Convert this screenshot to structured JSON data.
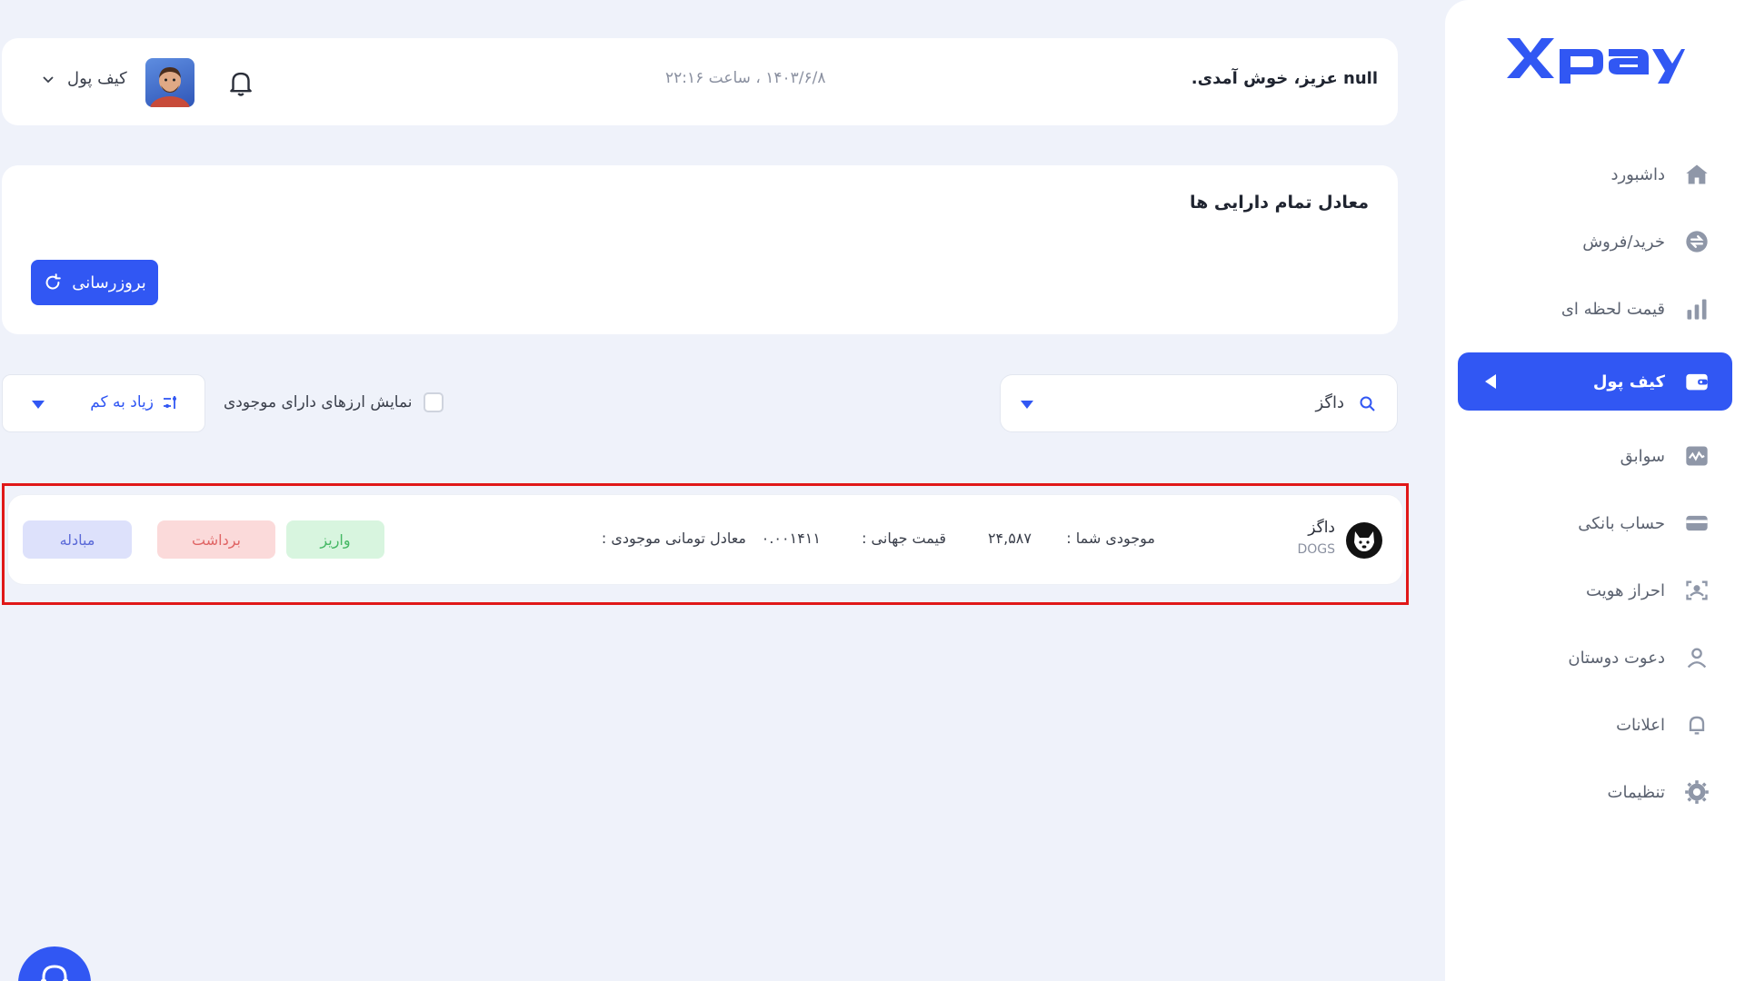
{
  "brand": {
    "logo_text": "xpay",
    "accent": "#3157f3"
  },
  "header": {
    "welcome": "null عزیز، خوش آمدی.",
    "datetime": "۱۴۰۳/۶/۸ ، ساعت ۲۲:۱۶",
    "wallet_label": "کیف پول"
  },
  "sidebar": {
    "items": [
      {
        "label": "داشبورد",
        "icon": "home-icon"
      },
      {
        "label": "خرید/فروش",
        "icon": "exchange-icon"
      },
      {
        "label": "قیمت لحظه ای",
        "icon": "bar-chart-icon"
      },
      {
        "label": "کیف پول",
        "icon": "wallet-icon",
        "active": true
      },
      {
        "label": "سوابق",
        "icon": "history-icon"
      },
      {
        "label": "حساب بانکی",
        "icon": "card-icon"
      },
      {
        "label": "احراز هویت",
        "icon": "id-scan-icon"
      },
      {
        "label": "دعوت دوستان",
        "icon": "user-icon"
      },
      {
        "label": "اعلانات",
        "icon": "bell-icon"
      },
      {
        "label": "تنظیمات",
        "icon": "gear-icon"
      }
    ]
  },
  "summary": {
    "title": "معادل تمام دارایی ها",
    "refresh_label": "بروزرسانی"
  },
  "filters": {
    "search_value": "داگز",
    "show_with_balance_label": "نمایش ارزهای دارای موجودی",
    "sort_label": "زیاد به کم"
  },
  "asset": {
    "name": "داگز",
    "symbol": "DOGS",
    "balance_label": "موجودی شما :",
    "balance_value": "۲۴,۵۸۷",
    "global_price_label": "قیمت جهانی :",
    "global_price_value": "۰.۰۰۱۴۱۱",
    "toman_equiv_label": "معادل تومانی موجودی :",
    "deposit_label": "واریز",
    "withdraw_label": "برداشت",
    "exchange_label": "مبادله"
  }
}
